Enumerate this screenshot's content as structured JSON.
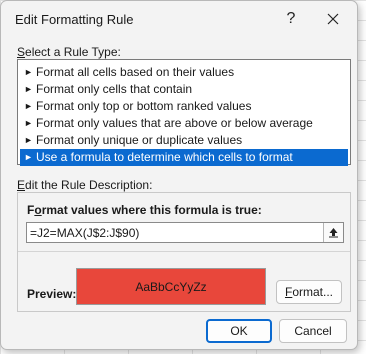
{
  "dialog": {
    "title": "Edit Formatting Rule",
    "help_label": "?",
    "select_rule_label_key": "S",
    "select_rule_label_rest": "elect a Rule Type:",
    "rule_types": [
      {
        "label": "Format all cells based on their values",
        "selected": false
      },
      {
        "label": "Format only cells that contain",
        "selected": false
      },
      {
        "label": "Format only top or bottom ranked values",
        "selected": false
      },
      {
        "label": "Format only values that are above or below average",
        "selected": false
      },
      {
        "label": "Format only unique or duplicate values",
        "selected": false
      },
      {
        "label": "Use a formula to determine which cells to format",
        "selected": true
      }
    ],
    "edit_desc_label_key": "E",
    "edit_desc_label_rest": "dit the Rule Description:",
    "formula_label_pre": "F",
    "formula_label_key": "o",
    "formula_label_rest": "rmat values where this formula is true:",
    "formula_value": "=J2=MAX(J$2:J$90)",
    "preview_label": "Preview:",
    "preview_text": "AaBbCcYyZz",
    "preview_fill_color": "#e8473b",
    "format_button_key": "F",
    "format_button_rest": "ormat...",
    "ok_label": "OK",
    "cancel_label": "Cancel",
    "accent_color": "#0b6ad0"
  }
}
